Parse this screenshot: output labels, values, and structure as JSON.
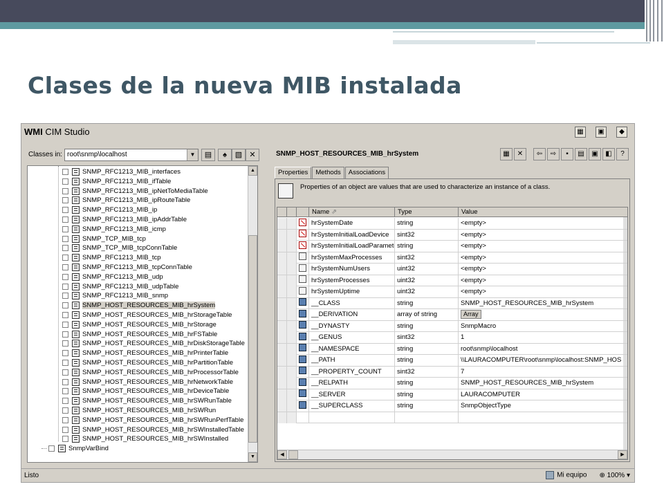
{
  "slide": {
    "title": "Clases de la nueva MIB instalada"
  },
  "app": {
    "name_bold": "WMI",
    "name_rest": " CIM Studio",
    "classes_in_label": "Classes in:",
    "namespace": "root\\snmp\\localhost"
  },
  "tree": {
    "items": [
      "SNMP_RFC1213_MIB_interfaces",
      "SNMP_RFC1213_MIB_ifTable",
      "SNMP_RFC1213_MIB_ipNetToMediaTable",
      "SNMP_RFC1213_MIB_ipRouteTable",
      "SNMP_RFC1213_MIB_ip",
      "SNMP_RFC1213_MIB_ipAddrTable",
      "SNMP_RFC1213_MIB_icmp",
      "SNMP_TCP_MIB_tcp",
      "SNMP_TCP_MIB_tcpConnTable",
      "SNMP_RFC1213_MIB_tcp",
      "SNMP_RFC1213_MIB_tcpConnTable",
      "SNMP_RFC1213_MIB_udp",
      "SNMP_RFC1213_MIB_udpTable",
      "SNMP_RFC1213_MIB_snmp",
      "SNMP_HOST_RESOURCES_MIB_hrSystem",
      "SNMP_HOST_RESOURCES_MIB_hrStorageTable",
      "SNMP_HOST_RESOURCES_MIB_hrStorage",
      "SNMP_HOST_RESOURCES_MIB_hrFSTable",
      "SNMP_HOST_RESOURCES_MIB_hrDiskStorageTable",
      "SNMP_HOST_RESOURCES_MIB_hrPrinterTable",
      "SNMP_HOST_RESOURCES_MIB_hrPartitionTable",
      "SNMP_HOST_RESOURCES_MIB_hrProcessorTable",
      "SNMP_HOST_RESOURCES_MIB_hrNetworkTable",
      "SNMP_HOST_RESOURCES_MIB_hrDeviceTable",
      "SNMP_HOST_RESOURCES_MIB_hrSWRunTable",
      "SNMP_HOST_RESOURCES_MIB_hrSWRun",
      "SNMP_HOST_RESOURCES_MIB_hrSWRunPerfTable",
      "SNMP_HOST_RESOURCES_MIB_hrSWInstalledTable",
      "SNMP_HOST_RESOURCES_MIB_hrSWInstalled"
    ],
    "selected_index": 14,
    "last_item": "SnmpVarBind"
  },
  "details": {
    "class_name": "SNMP_HOST_RESOURCES_MIB_hrSystem",
    "tabs": [
      "Properties",
      "Methods",
      "Associations"
    ],
    "description": "Properties of an object are values that are used to characterize an instance of a class.",
    "columns": {
      "name": "Name",
      "type": "Type",
      "value": "Value"
    },
    "rows": [
      {
        "icon": "key",
        "name": "hrSystemDate",
        "type": "string",
        "value": "<empty>"
      },
      {
        "icon": "key",
        "name": "hrSystemInitialLoadDevice",
        "type": "sint32",
        "value": "<empty>"
      },
      {
        "icon": "key",
        "name": "hrSystemInitialLoadParamete",
        "type": "string",
        "value": "<empty>"
      },
      {
        "icon": "prop",
        "name": "hrSystemMaxProcesses",
        "type": "sint32",
        "value": "<empty>"
      },
      {
        "icon": "prop",
        "name": "hrSystemNumUsers",
        "type": "uint32",
        "value": "<empty>"
      },
      {
        "icon": "prop",
        "name": "hrSystemProcesses",
        "type": "uint32",
        "value": "<empty>"
      },
      {
        "icon": "prop",
        "name": "hrSystemUptime",
        "type": "uint32",
        "value": "<empty>"
      },
      {
        "icon": "sys",
        "name": "__CLASS",
        "type": "string",
        "value": "SNMP_HOST_RESOURCES_MIB_hrSystem"
      },
      {
        "icon": "sys",
        "name": "__DERIVATION",
        "type": "array of string",
        "value": "Array"
      },
      {
        "icon": "sys",
        "name": "__DYNASTY",
        "type": "string",
        "value": "SnmpMacro"
      },
      {
        "icon": "sys",
        "name": "__GENUS",
        "type": "sint32",
        "value": "1"
      },
      {
        "icon": "sys",
        "name": "__NAMESPACE",
        "type": "string",
        "value": "root\\snmp\\localhost"
      },
      {
        "icon": "sys",
        "name": "__PATH",
        "type": "string",
        "value": "\\\\LAURACOMPUTER\\root\\snmp\\localhost:SNMP_HOS"
      },
      {
        "icon": "sys",
        "name": "__PROPERTY_COUNT",
        "type": "sint32",
        "value": "7"
      },
      {
        "icon": "sys",
        "name": "__RELPATH",
        "type": "string",
        "value": "SNMP_HOST_RESOURCES_MIB_hrSystem"
      },
      {
        "icon": "sys",
        "name": "__SERVER",
        "type": "string",
        "value": "LAURACOMPUTER"
      },
      {
        "icon": "sys",
        "name": "__SUPERCLASS",
        "type": "string",
        "value": "SnmpObjectType"
      }
    ]
  },
  "status": {
    "left": "Listo",
    "zone": "Mi equipo",
    "zoom": "100%"
  }
}
